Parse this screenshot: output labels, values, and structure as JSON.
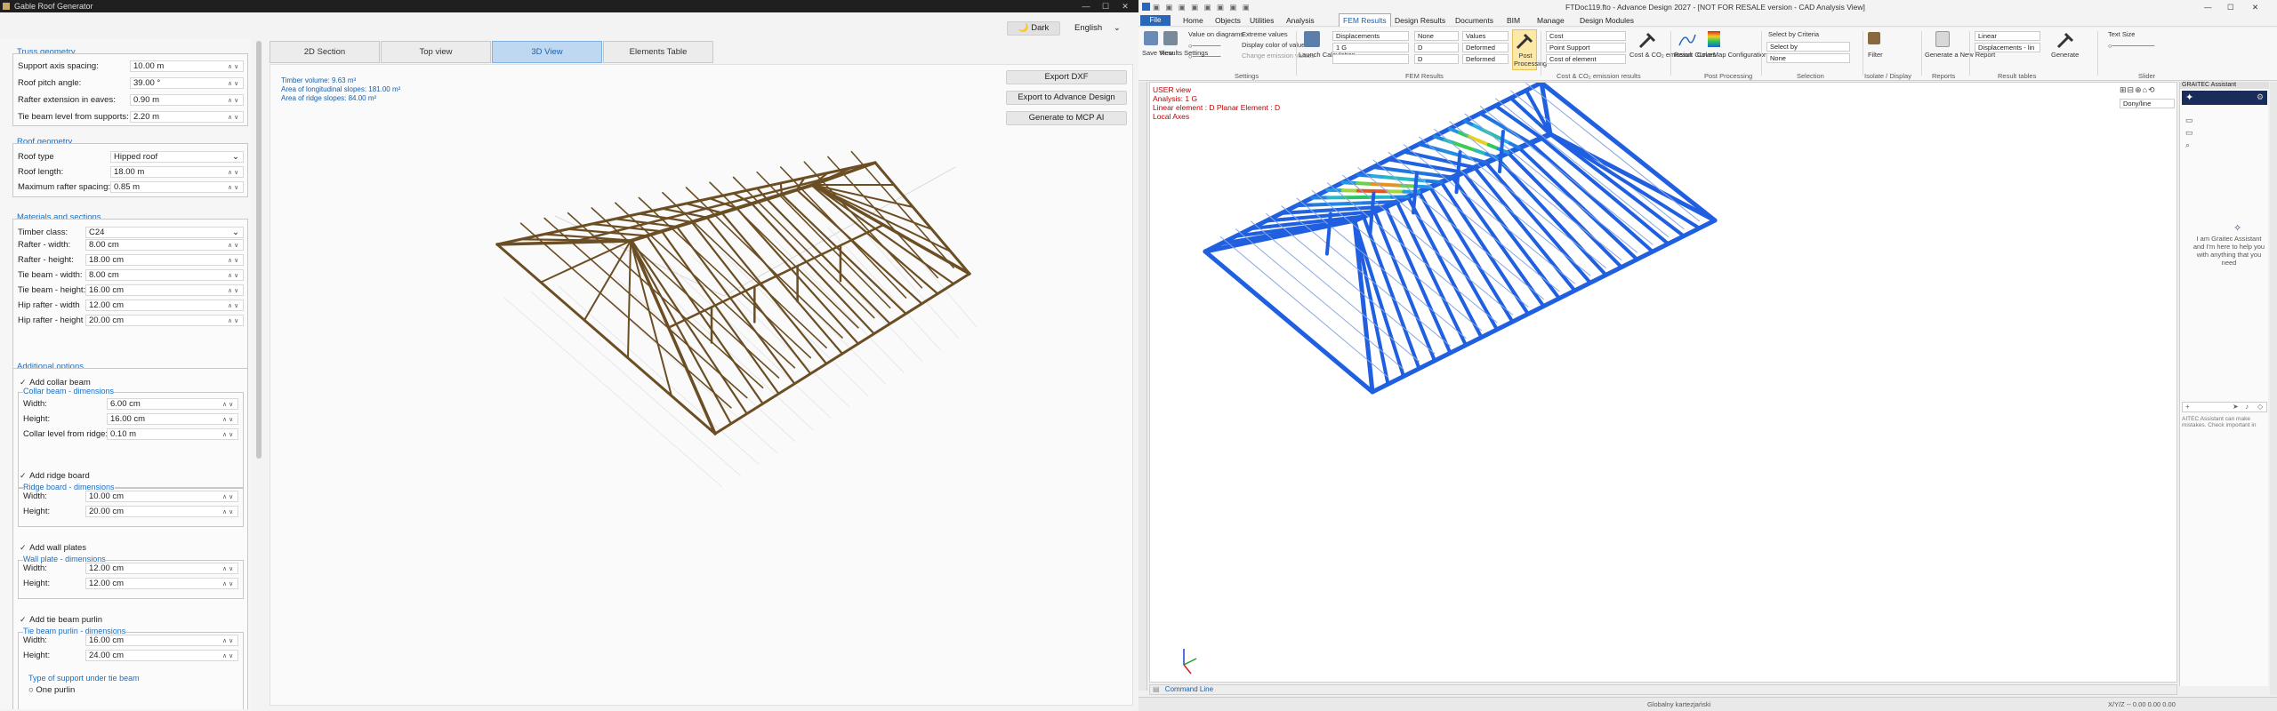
{
  "left_window": {
    "title": "Gable Roof Generator",
    "theme_button": "Dark",
    "language": "English",
    "tabs": [
      "2D Section",
      "Top view",
      "3D View",
      "Elements Table"
    ],
    "info": {
      "timber_volume": "Timber volume: 9.63 m³",
      "long_slopes": "Area of longitudinal slopes: 181.00 m²",
      "ridge_slopes": "Area of ridge slopes: 84.00 m²"
    },
    "buttons": {
      "export_dxf": "Export DXF",
      "export_ad": "Export to Advance Design",
      "generate_mcp": "Generate to MCP AI"
    },
    "truss_geometry": {
      "title": "Truss geometry",
      "fields": [
        {
          "label": "Support axis spacing:",
          "value": "10.00 m"
        },
        {
          "label": "Roof pitch angle:",
          "value": "39.00 °"
        },
        {
          "label": "Rafter extension in eaves:",
          "value": "0.90 m"
        },
        {
          "label": "Tie beam level from supports:",
          "value": "2.20 m"
        }
      ]
    },
    "roof_geometry": {
      "title": "Roof geometry",
      "roof_type_label": "Roof type",
      "roof_type_value": "Hipped roof",
      "fields": [
        {
          "label": "Roof length:",
          "value": "18.00 m"
        },
        {
          "label": "Maximum rafter spacing:",
          "value": "0.85 m"
        }
      ]
    },
    "materials": {
      "title": "Materials and sections",
      "timber_class_label": "Timber class:",
      "timber_class_value": "C24",
      "fields": [
        {
          "label": "Rafter - width:",
          "value": "8.00 cm"
        },
        {
          "label": "Rafter - height:",
          "value": "18.00 cm"
        },
        {
          "label": "Tie beam - width:",
          "value": "8.00 cm"
        },
        {
          "label": "Tie beam - height:",
          "value": "16.00 cm"
        },
        {
          "label": "Hip rafter - width",
          "value": "12.00 cm"
        },
        {
          "label": "Hip rafter - height",
          "value": "20.00 cm"
        }
      ]
    },
    "additional": {
      "title": "Additional options",
      "add_collar_beam": "Add collar beam",
      "collar_dims": "Collar beam - dimensions",
      "collar_fields": [
        {
          "label": "Width:",
          "value": "6.00 cm"
        },
        {
          "label": "Height:",
          "value": "16.00 cm"
        },
        {
          "label": "Collar level from ridge:",
          "value": "0.10 m"
        }
      ],
      "add_ridge_board": "Add ridge board",
      "ridge_dims": "Ridge board - dimensions",
      "ridge_fields": [
        {
          "label": "Width:",
          "value": "10.00 cm"
        },
        {
          "label": "Height:",
          "value": "20.00 cm"
        }
      ],
      "add_wall_plates": "Add wall plates",
      "wall_dims": "Wall plate - dimensions",
      "wall_fields": [
        {
          "label": "Width:",
          "value": "12.00 cm"
        },
        {
          "label": "Height:",
          "value": "12.00 cm"
        }
      ],
      "add_tie_purlin": "Add tie beam purlin",
      "tie_dims": "Tie beam purlin - dimensions",
      "tie_fields": [
        {
          "label": "Width:",
          "value": "16.00 cm"
        },
        {
          "label": "Height:",
          "value": "24.00 cm"
        }
      ],
      "support_type": "Type of support under tie beam",
      "one_purlin": "One purlin"
    }
  },
  "right_window": {
    "title": "FTDoc119.fto - Advance Design 2027 - [NOT FOR RESALE version - CAD Analysis View]",
    "file_button": "File",
    "menu": [
      "Home",
      "Objects",
      "Utilities",
      "Analysis",
      "FEM Results",
      "Design Results",
      "Documents",
      "BIM",
      "Manage",
      "Design Modules"
    ],
    "active_menu": "FEM Results",
    "ribbon": {
      "save_view": "Save View",
      "results_settings": "Results Settings",
      "value_on_diagrams": "Value on diagrams",
      "extreme_values": "Extreme values",
      "display_color": "Display color of values",
      "change_emission": "Change emission values",
      "settings_group": "Settings",
      "launch_calc": "Launch Calculation",
      "displacements": "Displacements",
      "load_case": "1 G",
      "none": "None",
      "values": "Values",
      "deformed": "Deformed",
      "zero": "D",
      "fem_group": "FEM Results",
      "post_processing": "Post Processing",
      "cost": "Cost",
      "point_support": "Point Support",
      "cost_of_element": "Cost of element",
      "cost_co2": "Cost & CO₂ emission",
      "cost_group": "Cost & CO₂ emission results",
      "result_curves": "Result Curves",
      "colormap": "ColorMap Configuration",
      "post_group": "Post Processing",
      "select_criteria": "Select by Criteria",
      "select_by": "Select by",
      "sel_none": "None",
      "selection_group": "Selection",
      "filter": "Filter",
      "isolate_group": "Isolate / Display",
      "generate_report": "Generate a New Report",
      "reports_group": "Reports",
      "linear": "Linear",
      "displacements_lin": "Displacements - lin",
      "generate": "Generate",
      "tables_group": "Result tables",
      "text_size": "Text Size",
      "slider_group": "Slider"
    },
    "viewport": {
      "view_name": "USER view",
      "analysis": "Analysis: 1  G",
      "element": "Linear element : D Planar Element : D",
      "axes": "Local Axes",
      "style_select": "Dony/line"
    },
    "assistant": {
      "title": "GRAITEC Assistant",
      "greeting": "I am Graitec Assistant and I'm here to help you with anything that you need",
      "disclaimer": "AITEC Assistant can make mistakes. Check important in"
    },
    "command_line": "Command Line",
    "status_text": "Globalny kartezjański",
    "status_coords": "X/Y/Z -- 0.00 0.00 0.00"
  },
  "colors": {
    "accent_blue": "#1a6fc4",
    "timber": "#6b4e24",
    "mesh_blue": "#1f5fe0",
    "result_red": "#e02020"
  }
}
